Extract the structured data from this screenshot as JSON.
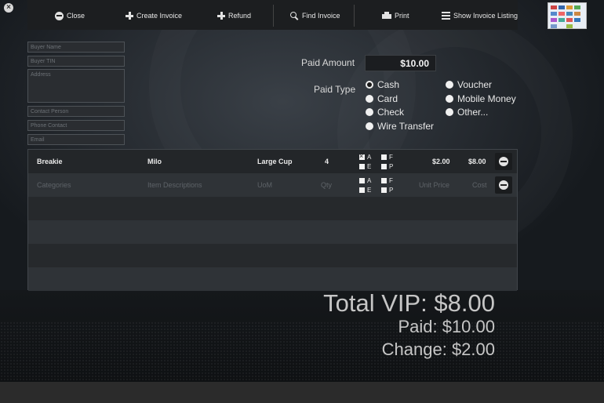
{
  "toolbar": {
    "close_label": "Close",
    "create_label": "Create Invoice",
    "refund_label": "Refund",
    "find_label": "Find Invoice",
    "print_label": "Print",
    "listing_label": "Show Invoice Listing"
  },
  "buyer": {
    "name_ph": "Buyer Name",
    "tin_ph": "Buyer TIN",
    "address_ph": "Address",
    "contact_ph": "Contact Person",
    "phone_ph": "Phone Contact",
    "email_ph": "Email"
  },
  "payment": {
    "paid_amount_label": "Paid Amount",
    "paid_amount_value": "$10.00",
    "paid_type_label": "Paid Type",
    "options": [
      "Cash",
      "Voucher",
      "Card",
      "Mobile Money",
      "Check",
      "Other...",
      "Wire Transfer"
    ],
    "selected": "Cash"
  },
  "items": {
    "row1": {
      "category": "Breakie",
      "description": "Milo",
      "uom": "Large Cup",
      "qty": "4",
      "flags": {
        "A": true,
        "F": false,
        "E": false,
        "P": false
      },
      "unit_price": "$2.00",
      "cost": "$8.00"
    },
    "placeholder": {
      "category": "Categories",
      "description": "Item Descriptions",
      "uom": "UoM",
      "qty": "Qty",
      "unit_price": "Unit Price",
      "cost": "Cost"
    },
    "flag_labels": {
      "a": "A",
      "f": "F",
      "e": "E",
      "p": "P"
    }
  },
  "totals": {
    "total": "Total VIP: $8.00",
    "paid": "Paid: $10.00",
    "change": "Change: $2.00"
  },
  "icons": [
    "close-icon",
    "minus-circle-icon",
    "plus-icon",
    "search-icon",
    "printer-icon",
    "list-icon"
  ]
}
